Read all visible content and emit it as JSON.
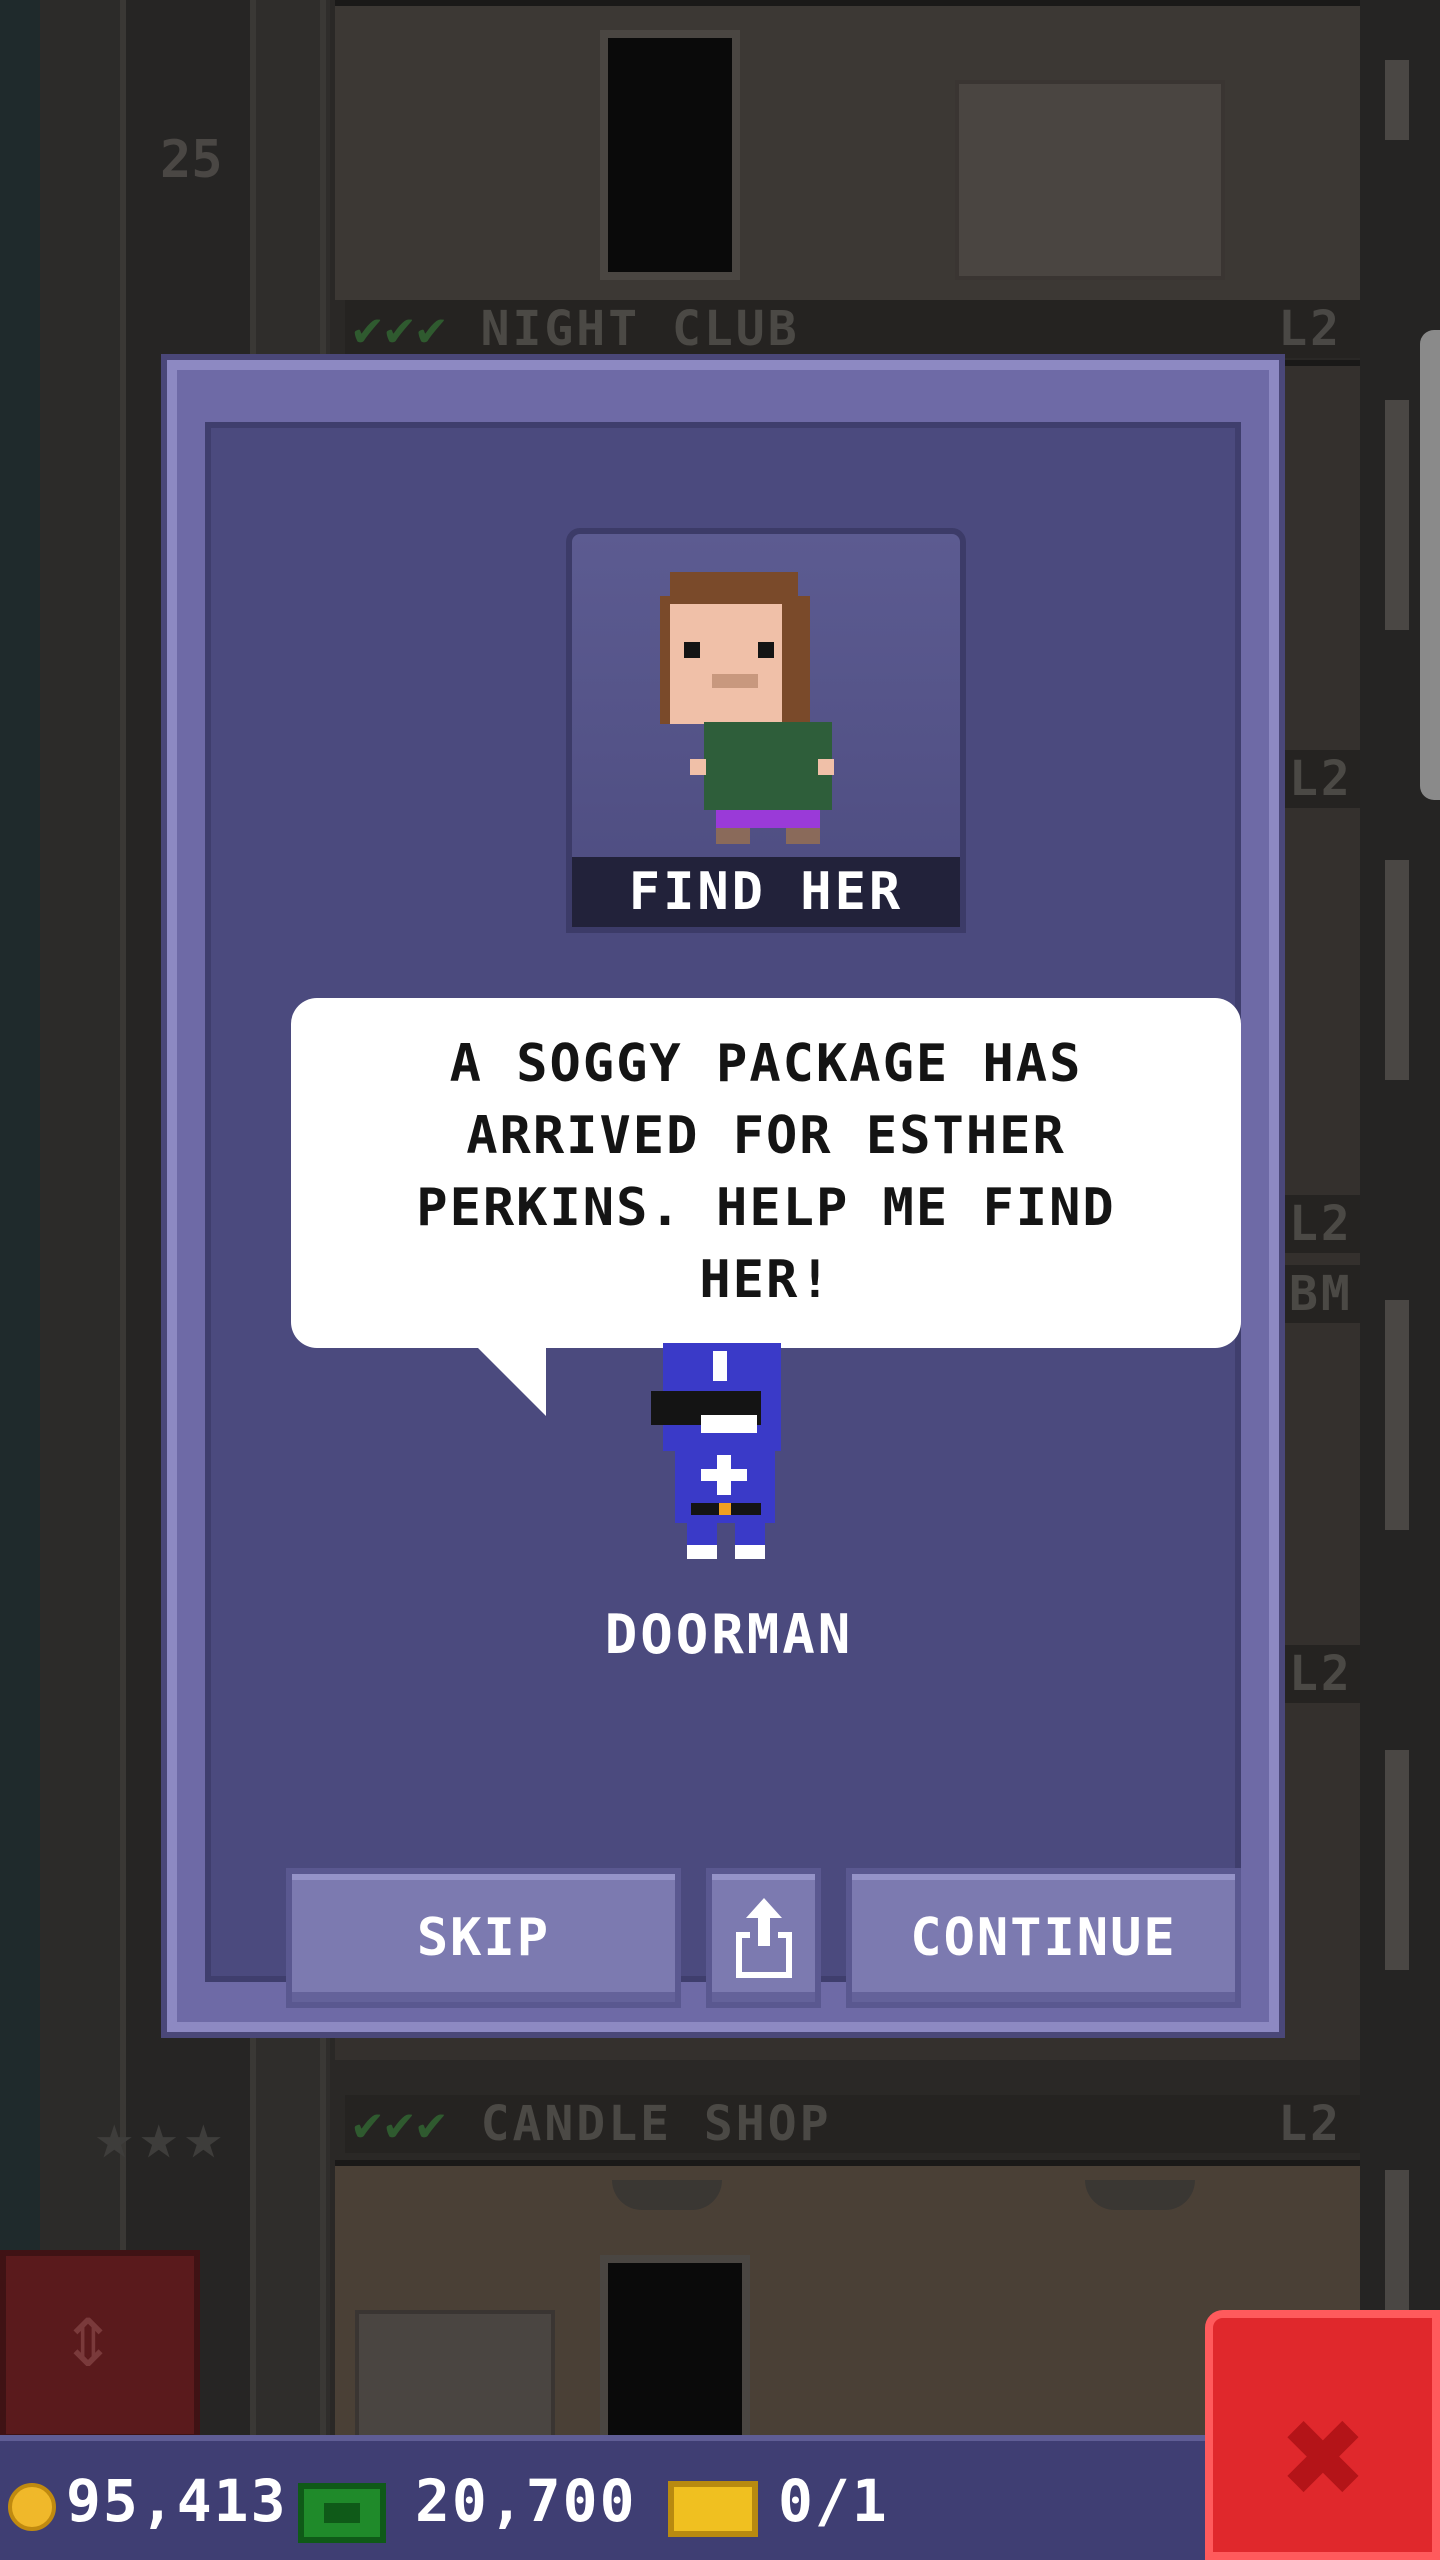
{
  "background": {
    "floor_number": "25",
    "floors": [
      {
        "name": "NIGHT CLUB",
        "checks": "✔✔✔",
        "level": "L2"
      },
      {
        "name": "CANDLE SHOP",
        "checks": "✔✔✔",
        "level": "L2"
      }
    ],
    "side_levels": [
      "L2",
      "L2",
      "L2"
    ],
    "side_fragment": "BM",
    "stars": "★★★"
  },
  "dialog": {
    "portrait_banner": "FIND HER",
    "message": "A SOGGY PACKAGE HAS ARRIVED FOR ESTHER PERKINS. HELP ME FIND HER!",
    "speaker_name": "DOORMAN",
    "buttons": {
      "skip": "SKIP",
      "continue": "CONTINUE"
    }
  },
  "hud": {
    "coins": "95,413",
    "bux": "20,700",
    "tickets": "0/1"
  },
  "icons": {
    "close": "close-icon",
    "share": "share-icon",
    "coin": "coin-icon",
    "bux": "bux-icon",
    "ticket": "ticket-icon",
    "elevator": "elevator-arrows-icon"
  },
  "colors": {
    "dialog_bg": "#4b4a7e",
    "dialog_border": "#8d89c2",
    "button": "#7c7ab0",
    "close_button": "#e0282c",
    "hud_bg": "#3f3e73"
  }
}
